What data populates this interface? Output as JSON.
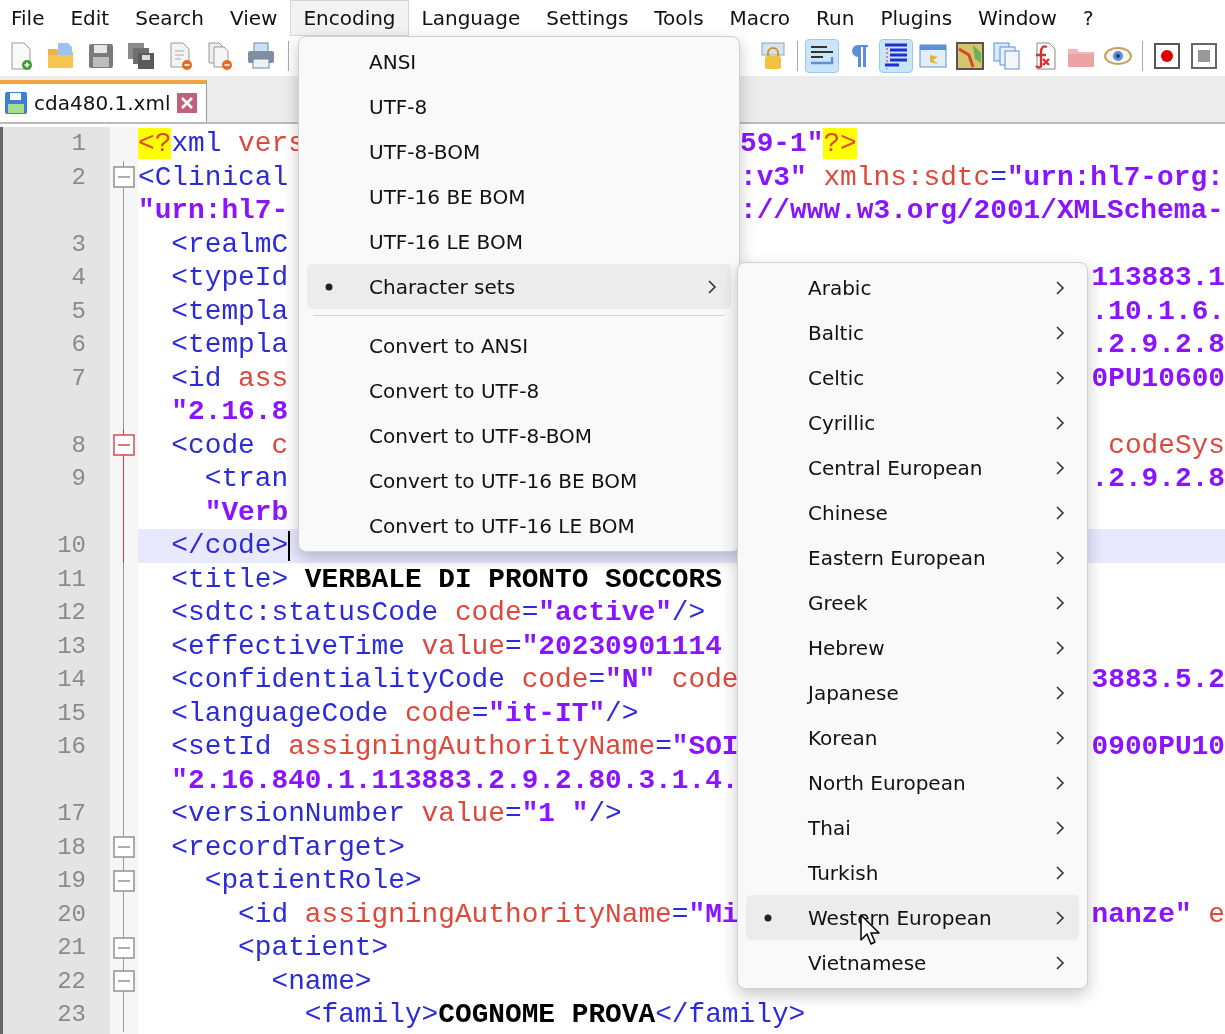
{
  "menubar": [
    {
      "label": "File",
      "selected": false
    },
    {
      "label": "Edit",
      "selected": false
    },
    {
      "label": "Search",
      "selected": false
    },
    {
      "label": "View",
      "selected": false
    },
    {
      "label": "Encoding",
      "selected": true
    },
    {
      "label": "Language",
      "selected": false
    },
    {
      "label": "Settings",
      "selected": false
    },
    {
      "label": "Tools",
      "selected": false
    },
    {
      "label": "Macro",
      "selected": false
    },
    {
      "label": "Run",
      "selected": false
    },
    {
      "label": "Plugins",
      "selected": false
    },
    {
      "label": "Window",
      "selected": false
    },
    {
      "label": "?",
      "selected": false
    }
  ],
  "toolbar": {
    "left": [
      {
        "kind": "new",
        "pressed": false
      },
      {
        "kind": "open",
        "pressed": false
      },
      {
        "kind": "save",
        "pressed": false
      },
      {
        "kind": "save-all",
        "pressed": false
      },
      {
        "kind": "close",
        "pressed": false
      },
      {
        "kind": "close-all",
        "pressed": false
      },
      {
        "kind": "print",
        "pressed": false
      }
    ],
    "right": [
      {
        "kind": "lock",
        "pressed": false
      },
      {
        "kind": "separator"
      },
      {
        "kind": "wrap",
        "pressed": true
      },
      {
        "kind": "pilcrow",
        "pressed": false
      },
      {
        "kind": "indent",
        "pressed": true
      },
      {
        "kind": "panel",
        "pressed": false
      },
      {
        "kind": "map",
        "pressed": false
      },
      {
        "kind": "docs",
        "pressed": false
      },
      {
        "kind": "function",
        "pressed": false
      },
      {
        "kind": "folder",
        "pressed": false
      },
      {
        "kind": "eye",
        "pressed": false
      },
      {
        "kind": "separator"
      },
      {
        "kind": "record",
        "pressed": false
      },
      {
        "kind": "stop",
        "pressed": false
      }
    ]
  },
  "tabs": [
    {
      "label": "cda480.1.xml",
      "selected": true
    }
  ],
  "editor": {
    "lines": [
      {
        "number": "1",
        "fold_box": false,
        "fold_current": false,
        "current": false,
        "left": [
          {
            "text": "<?",
            "kind": "pi"
          },
          {
            "text": "xml ",
            "kind": "tag"
          },
          {
            "text": "vers",
            "kind": "attr"
          }
        ],
        "right": {
          "flush_right": false,
          "tokens": [
            {
              "text": "59-1\"",
              "kind": "value"
            },
            {
              "text": "?>",
              "kind": "pi"
            }
          ]
        }
      },
      {
        "number": "2",
        "fold_box": true,
        "fold_current": false,
        "current": false,
        "left": [
          {
            "text": "<Clinical",
            "kind": "tag"
          }
        ],
        "right": {
          "flush_right": false,
          "tokens": [
            {
              "text": ":v3\"",
              "kind": "value"
            },
            {
              "text": " xmlns:sdtc",
              "kind": "attr"
            },
            {
              "text": "=",
              "kind": "tag"
            },
            {
              "text": "\"urn:hl7-org:",
              "kind": "value"
            }
          ]
        }
      },
      {
        "fold_box": false,
        "fold_current": false,
        "current": false,
        "left": [
          {
            "text": "\"urn:hl7-",
            "kind": "value"
          }
        ],
        "right": {
          "flush_right": false,
          "tokens": [
            {
              "text": "://www.w3.org/2001/XMLSchema-",
              "kind": "value"
            }
          ]
        }
      },
      {
        "number": "3",
        "fold_box": false,
        "fold_current": false,
        "current": false,
        "left": [
          {
            "text": "  <realmC",
            "kind": "tag"
          }
        ]
      },
      {
        "number": "4",
        "fold_box": false,
        "fold_current": false,
        "current": false,
        "left": [
          {
            "text": "  <typeId",
            "kind": "tag"
          }
        ],
        "right": {
          "flush_right": true,
          "tokens": [
            {
              "text": "113883.1",
              "kind": "value"
            }
          ]
        }
      },
      {
        "number": "5",
        "fold_box": false,
        "fold_current": false,
        "current": false,
        "left": [
          {
            "text": "  <templa",
            "kind": "tag"
          }
        ],
        "right": {
          "flush_right": true,
          "tokens": [
            {
              "text": ".10.1.6.",
              "kind": "value"
            }
          ]
        }
      },
      {
        "number": "6",
        "fold_box": false,
        "fold_current": false,
        "current": false,
        "left": [
          {
            "text": "  <templa",
            "kind": "tag"
          }
        ],
        "right": {
          "flush_right": true,
          "tokens": [
            {
              "text": ".2.9.2.8",
              "kind": "value"
            }
          ]
        }
      },
      {
        "number": "7",
        "fold_box": false,
        "fold_current": false,
        "current": false,
        "left": [
          {
            "text": "  <id ",
            "kind": "tag"
          },
          {
            "text": "ass",
            "kind": "attr"
          }
        ],
        "right": {
          "flush_right": true,
          "tokens": [
            {
              "text": "0PU10600",
              "kind": "value"
            }
          ]
        }
      },
      {
        "fold_box": false,
        "fold_current": false,
        "current": false,
        "left": [
          {
            "text": "  \"2.16.8",
            "kind": "value"
          }
        ]
      },
      {
        "number": "8",
        "fold_box": true,
        "fold_current": true,
        "current": false,
        "left": [
          {
            "text": "  <code ",
            "kind": "tag"
          },
          {
            "text": "c",
            "kind": "attr"
          }
        ],
        "right": {
          "flush_right": true,
          "tokens": [
            {
              "text": "codeSys",
              "kind": "attr"
            }
          ]
        }
      },
      {
        "number": "9",
        "fold_box": false,
        "fold_current": true,
        "current": false,
        "left": [
          {
            "text": "    <tran",
            "kind": "tag"
          }
        ],
        "right": {
          "flush_right": true,
          "tokens": [
            {
              "text": ".2.9.2.8",
              "kind": "value"
            }
          ]
        }
      },
      {
        "fold_box": false,
        "fold_current": true,
        "current": false,
        "left": [
          {
            "text": "    \"Verb",
            "kind": "value"
          }
        ]
      },
      {
        "number": "10",
        "fold_box": false,
        "fold_current": true,
        "current": true,
        "left": [
          {
            "text": "  </code>",
            "kind": "tag"
          }
        ]
      },
      {
        "number": "11",
        "fold_box": false,
        "fold_current": false,
        "current": false,
        "left": [
          {
            "text": "  <title> ",
            "kind": "tag"
          },
          {
            "text": "VERBALE DI PRONTO SOCCORS",
            "kind": "text"
          }
        ]
      },
      {
        "number": "12",
        "fold_box": false,
        "fold_current": false,
        "current": false,
        "left": [
          {
            "text": "  <sdtc:statusCode ",
            "kind": "tag"
          },
          {
            "text": "code",
            "kind": "attr"
          },
          {
            "text": "=",
            "kind": "tag"
          },
          {
            "text": "\"active\"",
            "kind": "value"
          },
          {
            "text": "/>",
            "kind": "tag"
          }
        ]
      },
      {
        "number": "13",
        "fold_box": false,
        "fold_current": false,
        "current": false,
        "left": [
          {
            "text": "  <effectiveTime ",
            "kind": "tag"
          },
          {
            "text": "value",
            "kind": "attr"
          },
          {
            "text": "=",
            "kind": "tag"
          },
          {
            "text": "\"20230901114",
            "kind": "value"
          }
        ]
      },
      {
        "number": "14",
        "fold_box": false,
        "fold_current": false,
        "current": false,
        "left": [
          {
            "text": "  <confidentialityCode ",
            "kind": "tag"
          },
          {
            "text": "code",
            "kind": "attr"
          },
          {
            "text": "=",
            "kind": "tag"
          },
          {
            "text": "\"N\"",
            "kind": "value"
          },
          {
            "text": " code",
            "kind": "attr"
          }
        ],
        "right": {
          "flush_right": true,
          "tokens": [
            {
              "text": "3883.5.2",
              "kind": "value"
            }
          ]
        }
      },
      {
        "number": "15",
        "fold_box": false,
        "fold_current": false,
        "current": false,
        "left": [
          {
            "text": "  <languageCode ",
            "kind": "tag"
          },
          {
            "text": "code",
            "kind": "attr"
          },
          {
            "text": "=",
            "kind": "tag"
          },
          {
            "text": "\"it-IT\"",
            "kind": "value"
          },
          {
            "text": "/>",
            "kind": "tag"
          }
        ]
      },
      {
        "number": "16",
        "fold_box": false,
        "fold_current": false,
        "current": false,
        "left": [
          {
            "text": "  <setId ",
            "kind": "tag"
          },
          {
            "text": "assigningAuthorityName",
            "kind": "attr"
          },
          {
            "text": "=",
            "kind": "tag"
          },
          {
            "text": "\"SOI",
            "kind": "value"
          }
        ],
        "right": {
          "flush_right": true,
          "tokens": [
            {
              "text": "0900PU10",
              "kind": "value"
            }
          ]
        }
      },
      {
        "fold_box": false,
        "fold_current": false,
        "current": false,
        "left": [
          {
            "text": "  \"2.16.840.1.113883.2.9.2.80.3.1.4.",
            "kind": "value"
          }
        ]
      },
      {
        "number": "17",
        "fold_box": false,
        "fold_current": false,
        "current": false,
        "left": [
          {
            "text": "  <versionNumber ",
            "kind": "tag"
          },
          {
            "text": "value",
            "kind": "attr"
          },
          {
            "text": "=",
            "kind": "tag"
          },
          {
            "text": "\"1 \"",
            "kind": "value"
          },
          {
            "text": "/>",
            "kind": "tag"
          }
        ]
      },
      {
        "number": "18",
        "fold_box": true,
        "fold_current": false,
        "current": false,
        "left": [
          {
            "text": "  <recordTarget>",
            "kind": "tag"
          }
        ]
      },
      {
        "number": "19",
        "fold_box": true,
        "fold_current": false,
        "current": false,
        "left": [
          {
            "text": "    <patientRole>",
            "kind": "tag"
          }
        ]
      },
      {
        "number": "20",
        "fold_box": false,
        "fold_current": false,
        "current": false,
        "left": [
          {
            "text": "      <id ",
            "kind": "tag"
          },
          {
            "text": "assigningAuthorityName",
            "kind": "attr"
          },
          {
            "text": "=",
            "kind": "tag"
          },
          {
            "text": "\"Mi",
            "kind": "value"
          }
        ],
        "right": {
          "flush_right": true,
          "tokens": [
            {
              "text": "nanze\"",
              "kind": "value"
            },
            {
              "text": " e",
              "kind": "attr"
            }
          ]
        }
      },
      {
        "number": "21",
        "fold_box": true,
        "fold_current": false,
        "current": false,
        "left": [
          {
            "text": "      <patient>",
            "kind": "tag"
          }
        ]
      },
      {
        "number": "22",
        "fold_box": true,
        "fold_current": false,
        "current": false,
        "left": [
          {
            "text": "        <name>",
            "kind": "tag"
          }
        ]
      },
      {
        "number": "23",
        "fold_box": false,
        "fold_current": false,
        "current": false,
        "left": [
          {
            "text": "          <family>",
            "kind": "tag"
          },
          {
            "text": "COGNOME PROVA",
            "kind": "text"
          },
          {
            "text": "</family>",
            "kind": "tag"
          }
        ]
      }
    ]
  },
  "encoding_menu": [
    {
      "kind": "item",
      "label": "ANSI",
      "checked": false,
      "highlighted": false,
      "submenu": false
    },
    {
      "kind": "item",
      "label": "UTF-8",
      "checked": false,
      "highlighted": false,
      "submenu": false
    },
    {
      "kind": "item",
      "label": "UTF-8-BOM",
      "checked": false,
      "highlighted": false,
      "submenu": false
    },
    {
      "kind": "item",
      "label": "UTF-16 BE BOM",
      "checked": false,
      "highlighted": false,
      "submenu": false
    },
    {
      "kind": "item",
      "label": "UTF-16 LE BOM",
      "checked": false,
      "highlighted": false,
      "submenu": false
    },
    {
      "kind": "item",
      "label": "Character sets",
      "checked": true,
      "highlighted": true,
      "submenu": true
    },
    {
      "kind": "separator"
    },
    {
      "kind": "item",
      "label": "Convert to ANSI",
      "checked": false,
      "highlighted": false,
      "submenu": false
    },
    {
      "kind": "item",
      "label": "Convert to UTF-8",
      "checked": false,
      "highlighted": false,
      "submenu": false
    },
    {
      "kind": "item",
      "label": "Convert to UTF-8-BOM",
      "checked": false,
      "highlighted": false,
      "submenu": false
    },
    {
      "kind": "item",
      "label": "Convert to UTF-16 BE BOM",
      "checked": false,
      "highlighted": false,
      "submenu": false
    },
    {
      "kind": "item",
      "label": "Convert to UTF-16 LE BOM",
      "checked": false,
      "highlighted": false,
      "submenu": false
    }
  ],
  "charset_menu": [
    {
      "kind": "item",
      "label": "Arabic",
      "checked": false,
      "highlighted": false,
      "submenu": true
    },
    {
      "kind": "item",
      "label": "Baltic",
      "checked": false,
      "highlighted": false,
      "submenu": true
    },
    {
      "kind": "item",
      "label": "Celtic",
      "checked": false,
      "highlighted": false,
      "submenu": true
    },
    {
      "kind": "item",
      "label": "Cyrillic",
      "checked": false,
      "highlighted": false,
      "submenu": true
    },
    {
      "kind": "item",
      "label": "Central European",
      "checked": false,
      "highlighted": false,
      "submenu": true
    },
    {
      "kind": "item",
      "label": "Chinese",
      "checked": false,
      "highlighted": false,
      "submenu": true
    },
    {
      "kind": "item",
      "label": "Eastern European",
      "checked": false,
      "highlighted": false,
      "submenu": true
    },
    {
      "kind": "item",
      "label": "Greek",
      "checked": false,
      "highlighted": false,
      "submenu": true
    },
    {
      "kind": "item",
      "label": "Hebrew",
      "checked": false,
      "highlighted": false,
      "submenu": true
    },
    {
      "kind": "item",
      "label": "Japanese",
      "checked": false,
      "highlighted": false,
      "submenu": true
    },
    {
      "kind": "item",
      "label": "Korean",
      "checked": false,
      "highlighted": false,
      "submenu": true
    },
    {
      "kind": "item",
      "label": "North European",
      "checked": false,
      "highlighted": false,
      "submenu": true
    },
    {
      "kind": "item",
      "label": "Thai",
      "checked": false,
      "highlighted": false,
      "submenu": true
    },
    {
      "kind": "item",
      "label": "Turkish",
      "checked": false,
      "highlighted": false,
      "submenu": true
    },
    {
      "kind": "item",
      "label": "Western European",
      "checked": true,
      "highlighted": true,
      "submenu": true
    },
    {
      "kind": "item",
      "label": "Vietnamese",
      "checked": false,
      "highlighted": false,
      "submenu": true
    }
  ]
}
